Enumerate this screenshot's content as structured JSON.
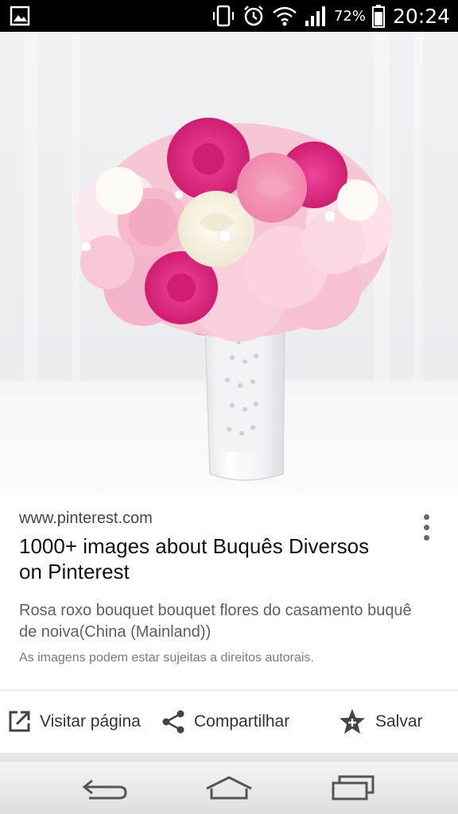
{
  "status_bar": {
    "battery_percent": "72%",
    "time": "20:24",
    "icons": [
      "gallery-icon",
      "vibrate-icon",
      "alarm-icon",
      "wifi-icon",
      "signal-icon",
      "battery-icon"
    ]
  },
  "photo": {
    "subject_icon": "bouquet-photo"
  },
  "result": {
    "domain": "www.pinterest.com",
    "title": "1000+ images about Buquês Diversos on Pinterest",
    "description": "Rosa roxo bouquet bouquet flores do casamento buquê de noiva(China (Mainland))",
    "copyright": "As imagens podem estar sujeitas a direitos autorais."
  },
  "actions": {
    "visit_label": "Visitar página",
    "share_label": "Compartilhar",
    "save_label": "Salvar"
  },
  "nav_bar": {
    "icons": [
      "back-icon",
      "home-icon",
      "recents-icon"
    ]
  },
  "colors": {
    "status_bar": "#000000",
    "text_primary": "#111111",
    "text_secondary": "#5f5f5f"
  }
}
